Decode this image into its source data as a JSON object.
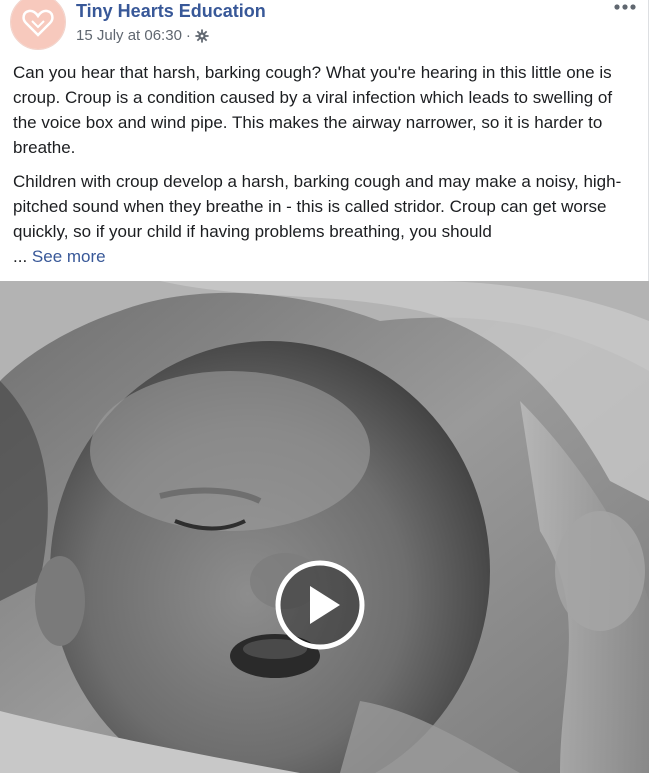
{
  "post": {
    "page_name": "Tiny Hearts Education",
    "timestamp": "15 July at 06:30",
    "separator": "·",
    "audience_icon": "gear-icon",
    "more_icon": "more-options-icon",
    "paragraphs": [
      "Can you hear that harsh, barking cough? What you're hearing in this little one is croup. Croup is a condition caused by a viral infection which leads to swelling of the voice box and wind pipe. This makes the airway narrower, so it is harder to breathe.",
      "Children with croup develop a harsh, barking cough and may make a noisy, high-pitched sound when they breathe in - this is called stridor. Croup can get worse quickly, so if your child if having problems breathing, you should"
    ],
    "ellipsis": "... ",
    "see_more_label": "See more"
  },
  "video": {
    "play_icon": "play-icon",
    "colors": {
      "page_name": "#385898",
      "text": "#1c1e21",
      "meta": "#606770"
    }
  }
}
